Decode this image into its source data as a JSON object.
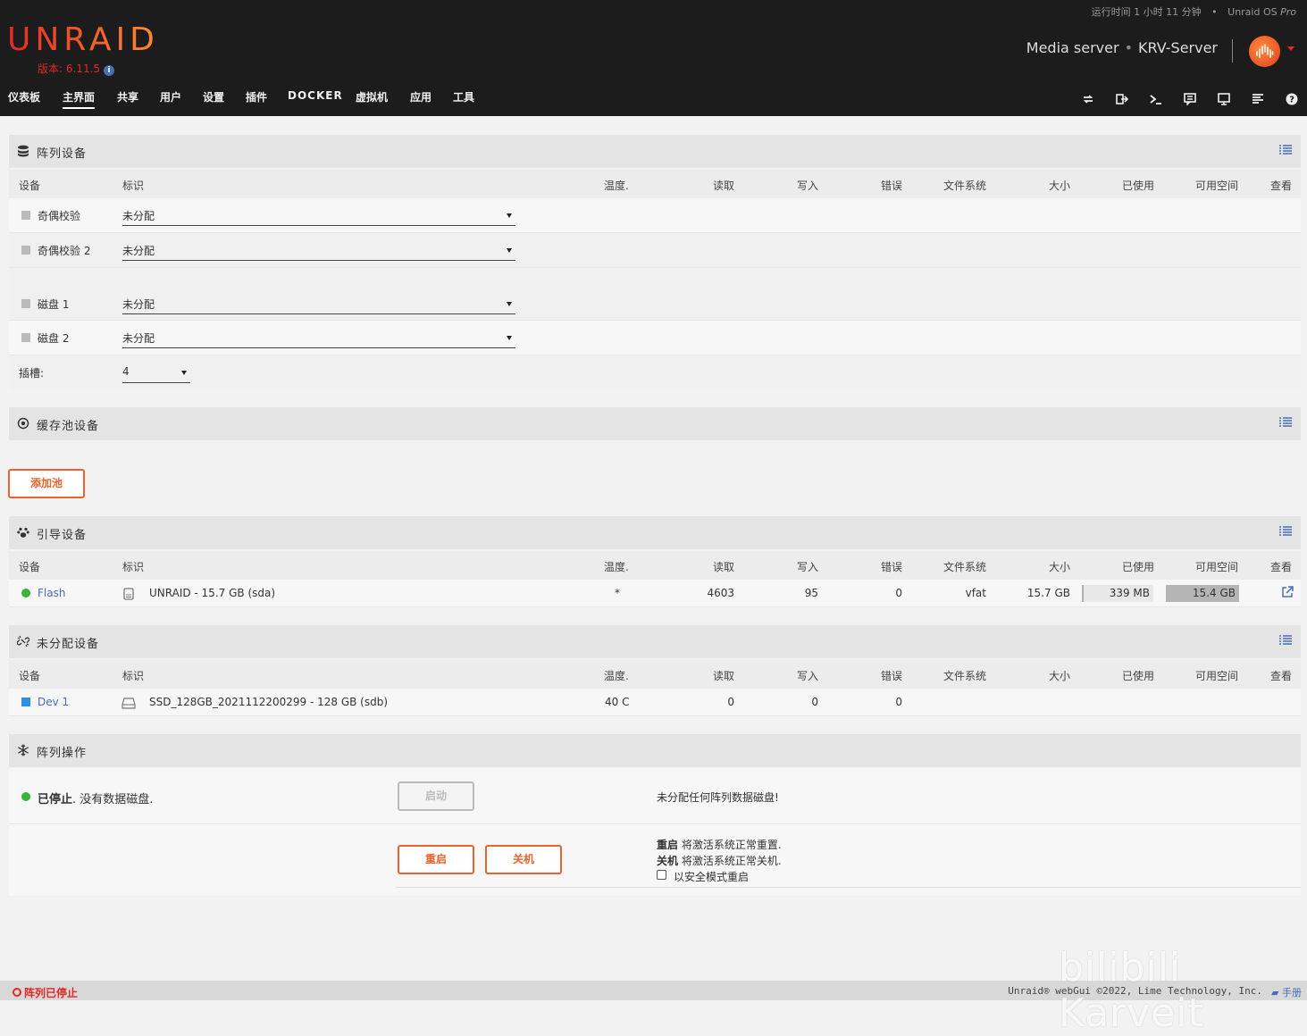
{
  "header": {
    "logo": "UNRAID",
    "version": "版本: 6.11.5",
    "uptime": "运行时间 1 小时 11 分钟",
    "edition_prefix": "Unraid OS",
    "edition_suffix": "Pro",
    "server_description": "Media server",
    "server_name": "KRV-Server"
  },
  "nav": {
    "items": [
      {
        "label": "仪表板"
      },
      {
        "label": "主界面"
      },
      {
        "label": "共享"
      },
      {
        "label": "用户"
      },
      {
        "label": "设置"
      },
      {
        "label": "插件"
      },
      {
        "label": "DOCKER"
      },
      {
        "label": "虚拟机"
      },
      {
        "label": "应用"
      },
      {
        "label": "工具"
      }
    ],
    "active_index": 1
  },
  "toolbar": {
    "icons": [
      "switch-language-icon",
      "logout-icon",
      "terminal-icon",
      "feedback-icon",
      "info-monitor-icon",
      "log-icon",
      "help-icon"
    ]
  },
  "columns": {
    "device": "设备",
    "identification": "标识",
    "temp": "温度.",
    "reads": "读取",
    "writes": "写入",
    "errors": "错误",
    "fs": "文件系统",
    "size": "大小",
    "used": "已使用",
    "free": "可用空间",
    "view": "查看"
  },
  "array": {
    "title": "阵列设备",
    "rows": [
      {
        "device": "奇偶校验",
        "ident": "未分配"
      },
      {
        "device": "奇偶校验 2",
        "ident": "未分配"
      },
      {
        "device": "磁盘 1",
        "ident": "未分配"
      },
      {
        "device": "磁盘 2",
        "ident": "未分配"
      }
    ],
    "slots_label": "插槽:",
    "slots_value": "4"
  },
  "pool": {
    "title": "缓存池设备",
    "add_button": "添加池"
  },
  "boot": {
    "title": "引导设备",
    "row": {
      "device": "Flash",
      "ident": "UNRAID - 15.7 GB (sda)",
      "temp": "*",
      "reads": "4603",
      "writes": "95",
      "errors": "0",
      "fs": "vfat",
      "size": "15.7 GB",
      "used": "339 MB",
      "free": "15.4 GB",
      "used_fraction": 0.02
    }
  },
  "unassigned": {
    "title": "未分配设备",
    "row": {
      "device": "Dev 1",
      "ident": "SSD_128GB_2021112200299 - 128 GB (sdb)",
      "temp": "40 C",
      "reads": "0",
      "writes": "0",
      "errors": "0"
    }
  },
  "operation": {
    "title": "阵列操作",
    "status_bold": "已停止",
    "status_rest": ". 没有数据磁盘.",
    "start_button": "启动",
    "start_note": "未分配任何阵列数据磁盘!",
    "reboot_button": "重启",
    "shutdown_button": "关机",
    "reboot_bold": "重启",
    "reboot_note": " 将激活系统正常重置.",
    "shutdown_bold": "关机",
    "shutdown_note": " 将激活系统正常关机.",
    "safe_mode_label": "以安全模式重启"
  },
  "footer": {
    "status": "阵列已停止",
    "copyright": "Unraid® webGui ©2022, Lime Technology, Inc.",
    "manual": "手册"
  },
  "watermark": "bilibili Karveit",
  "colors": {
    "brand": "#e22828",
    "accent": "#e9632d",
    "link": "#486dba",
    "green": "#3bb33b"
  }
}
